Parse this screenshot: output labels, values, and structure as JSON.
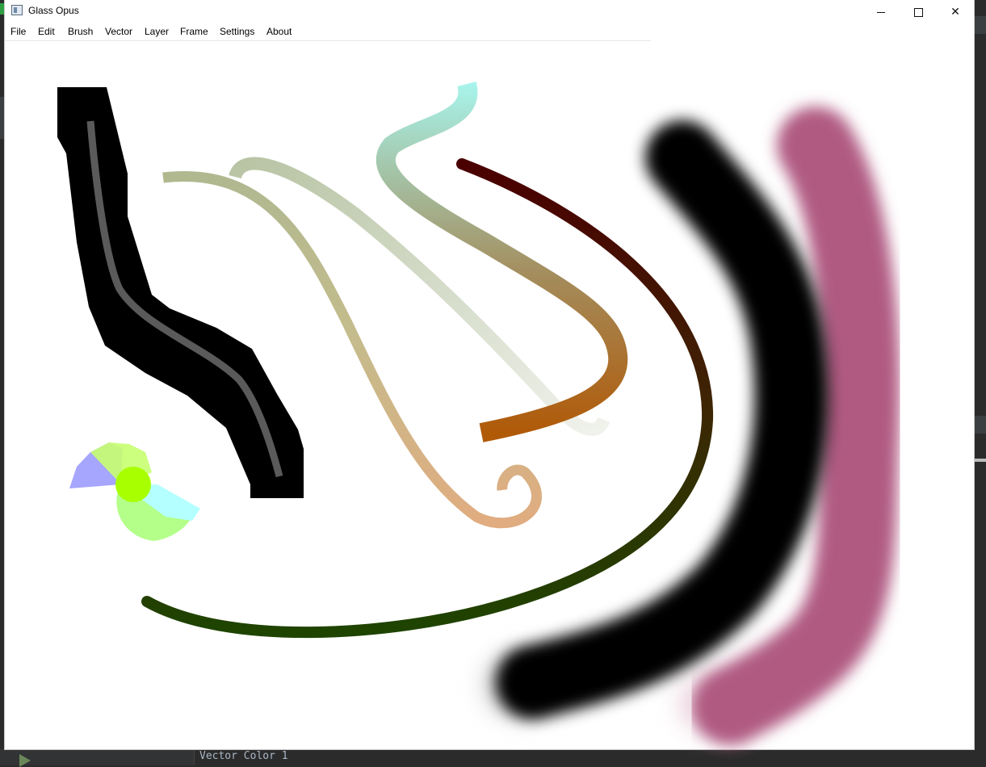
{
  "window": {
    "title": "Glass Opus",
    "controls": [
      "minimize",
      "maximize",
      "close"
    ]
  },
  "menu": [
    "File",
    "Edit",
    "Brush",
    "Vector",
    "Layer",
    "Frame",
    "Settings",
    "About"
  ],
  "status_bar": {
    "text": "Vector Color 1"
  },
  "colors": {
    "black_stroke": "#000000",
    "gray_center_line": "#5a5a5a",
    "olive_to_peach_start": "#b0b890",
    "olive_to_peach_end": "#e0ac80",
    "sage_to_white_start": "#b8c4a4",
    "cyan_to_orange_start": "#a8f4ec",
    "cyan_to_orange_end": "#b05a08",
    "maroon_to_green_start": "#4a0000",
    "maroon_to_green_end": "#1e4400",
    "pink_stroke": "#b05a82",
    "fan_colors": [
      "#a6a6ff",
      "#a8ff00",
      "#b4ffff"
    ]
  }
}
